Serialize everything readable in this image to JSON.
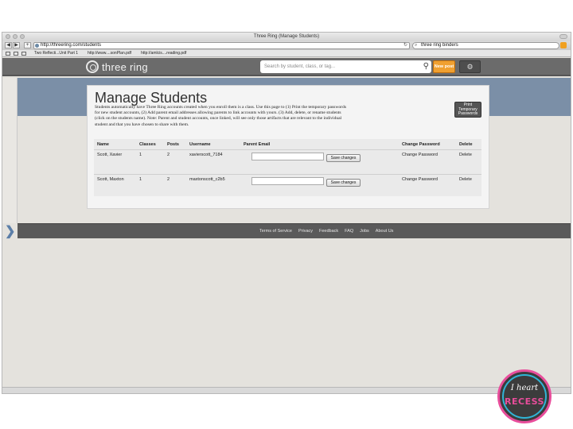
{
  "browser": {
    "window_title": "Three Ring (Manage Students)",
    "url": "http://threering.com/students",
    "search_query": "three ring binders",
    "back_label": "◀",
    "forward_label": "▶",
    "add_label": "+",
    "bookmarks": [
      "Two Reflecti...Unit Part 1",
      "http://www....sonPlan.pdf",
      "http://amlcis....reading.pdf"
    ]
  },
  "site": {
    "logo_text": "three ring",
    "search_placeholder": "Search by student, class, or tag...",
    "new_post_label": "New post",
    "settings_icon": "gear-icon"
  },
  "page": {
    "title": "Manage Students",
    "description": "Students automatically have Three Ring accounts created when you enroll them is a class. Use this page to (1) Print the temporary passwords for new student accounts, (2) Add parent email addresses allowing parents to link accounts with yours. (3) Add, delete, or rename students (click on the students name). Note: Parent and student accounts, once linked, will see only those artifacts that are relevant to the individual student and that you have chosen to share with them.",
    "print_button_label": "Print Temporary Passwords"
  },
  "table": {
    "columns": [
      "Name",
      "Classes",
      "Posts",
      "Username",
      "Parent Email",
      "Change Password",
      "Delete"
    ],
    "rows": [
      {
        "name": "Scott, Xavier",
        "classes": "1",
        "posts": "2",
        "username": "xavierscott_7184",
        "parent_email": "",
        "save_label": "Save changes",
        "change_password": "Change Password",
        "delete": "Delete"
      },
      {
        "name": "Scott, Maxton",
        "classes": "1",
        "posts": "2",
        "username": "maxtonscott_c2b5",
        "parent_email": "",
        "save_label": "Save changes",
        "change_password": "Change Password",
        "delete": "Delete"
      }
    ]
  },
  "footer": {
    "links": [
      "Terms of Service",
      "Privacy",
      "Feedback",
      "FAQ",
      "Jobs",
      "About Us"
    ]
  },
  "badge": {
    "top_text": "I heart",
    "bottom_text": "RECESS"
  },
  "colors": {
    "header_bg": "#6b6b6b",
    "band_bg": "#7b8fa7",
    "new_post": "#f0a030",
    "footer_bg": "#5a5a5a"
  }
}
